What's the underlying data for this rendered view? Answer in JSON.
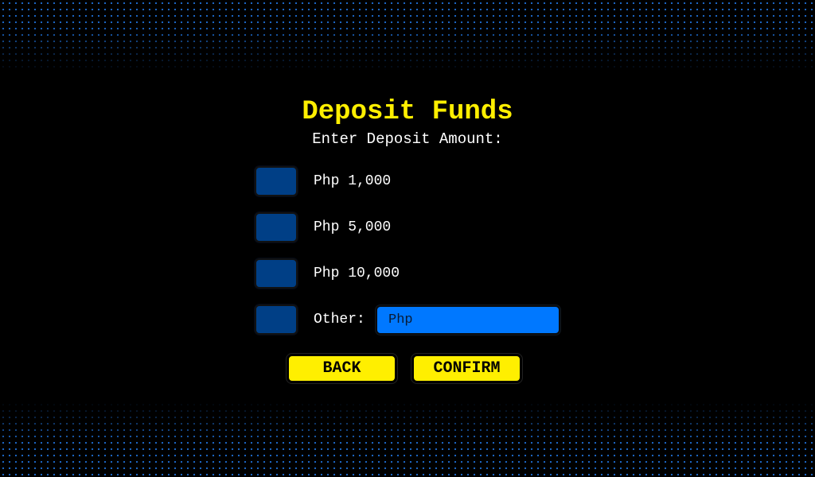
{
  "screen": {
    "title": "Deposit Funds",
    "subtitle": "Enter Deposit Amount:"
  },
  "options": [
    {
      "label": "Php 1,000"
    },
    {
      "label": "Php 5,000"
    },
    {
      "label": "Php 10,000"
    },
    {
      "label": "Other:"
    }
  ],
  "other_input": {
    "value": "",
    "placeholder": "Php"
  },
  "buttons": {
    "back_label": "BACK",
    "confirm_label": "CONFIRM"
  },
  "colors": {
    "background": "#000000",
    "accent_yellow": "#ffef00",
    "option_box_blue": "#003f86",
    "input_blue": "#0078ff",
    "dot_pattern_blue": "#1f6fd6"
  }
}
